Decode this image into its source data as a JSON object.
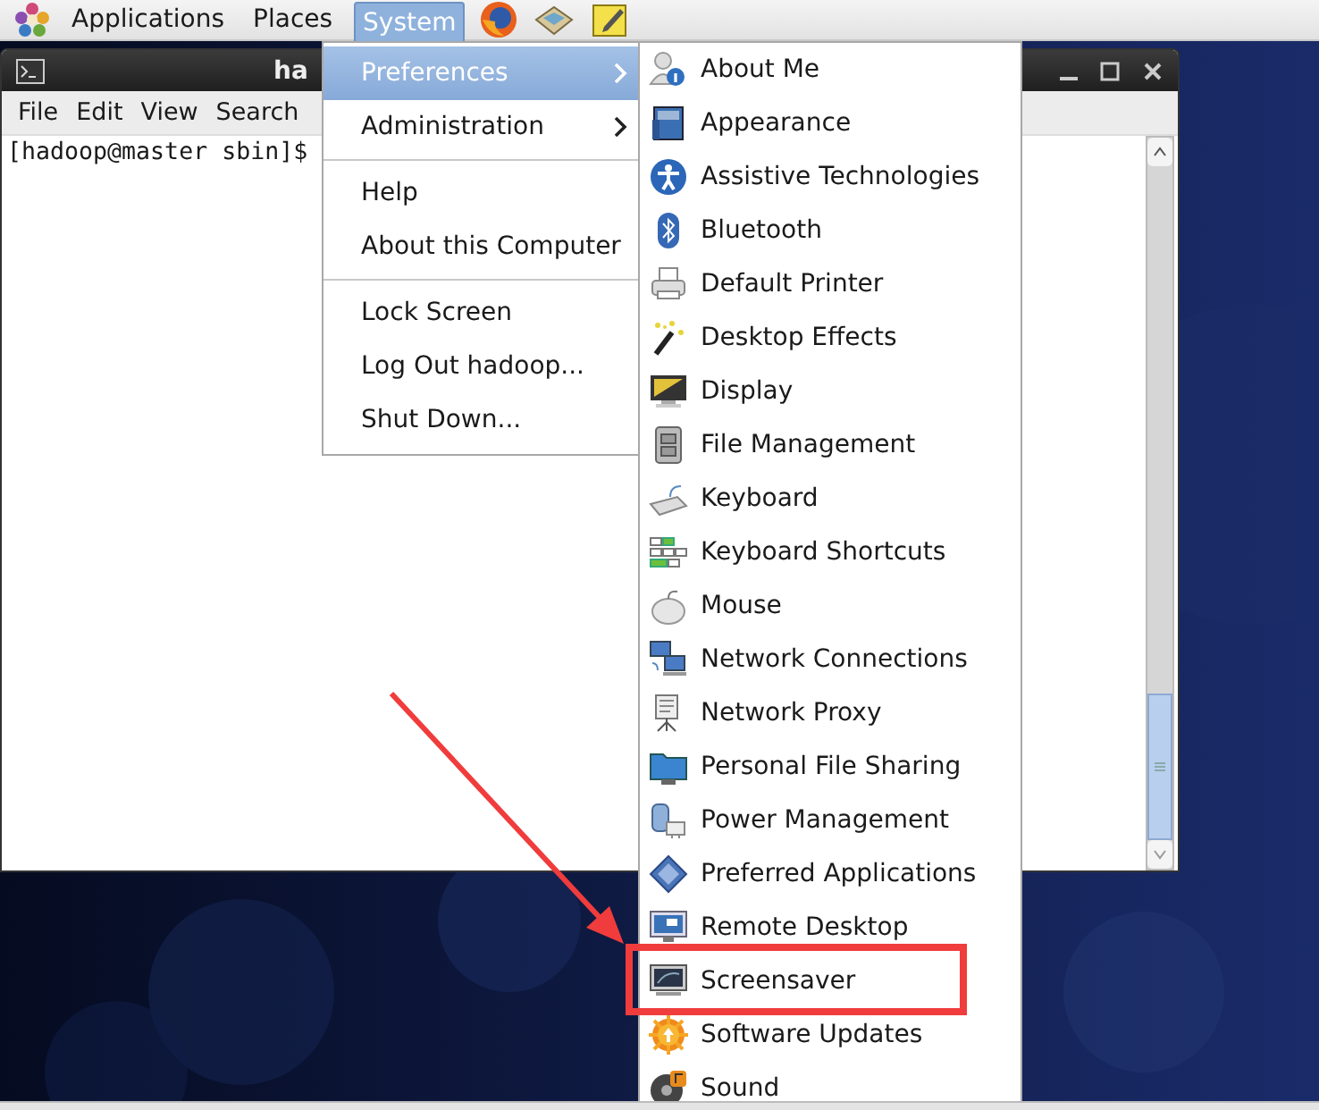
{
  "top_panel": {
    "menus": [
      {
        "label": "Applications",
        "selected": false
      },
      {
        "label": "Places",
        "selected": false
      },
      {
        "label": "System",
        "selected": true
      }
    ]
  },
  "terminal": {
    "title": "ha",
    "menus": [
      "File",
      "Edit",
      "View",
      "Search"
    ],
    "prompt": "[hadoop@master sbin]$ "
  },
  "system_menu": {
    "groups": [
      [
        {
          "label": "Preferences",
          "submenu": true,
          "selected": true
        },
        {
          "label": "Administration",
          "submenu": true,
          "selected": false
        }
      ],
      [
        {
          "label": "Help",
          "submenu": false,
          "selected": false
        },
        {
          "label": "About this Computer",
          "submenu": false,
          "selected": false
        }
      ],
      [
        {
          "label": "Lock Screen",
          "submenu": false,
          "selected": false
        },
        {
          "label": "Log Out hadoop...",
          "submenu": false,
          "selected": false
        },
        {
          "label": "Shut Down...",
          "submenu": false,
          "selected": false
        }
      ]
    ]
  },
  "preferences_menu": {
    "items": [
      {
        "label": "About Me",
        "selected": false
      },
      {
        "label": "Appearance",
        "selected": false
      },
      {
        "label": "Assistive Technologies",
        "selected": false
      },
      {
        "label": "Bluetooth",
        "selected": false
      },
      {
        "label": "Default Printer",
        "selected": false
      },
      {
        "label": "Desktop Effects",
        "selected": false
      },
      {
        "label": "Display",
        "selected": false
      },
      {
        "label": "File Management",
        "selected": false
      },
      {
        "label": "Keyboard",
        "selected": false
      },
      {
        "label": "Keyboard Shortcuts",
        "selected": false
      },
      {
        "label": "Mouse",
        "selected": false
      },
      {
        "label": "Network Connections",
        "selected": false
      },
      {
        "label": "Network Proxy",
        "selected": false
      },
      {
        "label": "Personal File Sharing",
        "selected": false
      },
      {
        "label": "Power Management",
        "selected": false
      },
      {
        "label": "Preferred Applications",
        "selected": false
      },
      {
        "label": "Remote Desktop",
        "selected": false
      },
      {
        "label": "Screensaver",
        "selected": false
      },
      {
        "label": "Software Updates",
        "selected": false
      },
      {
        "label": "Sound",
        "selected": false
      }
    ]
  }
}
